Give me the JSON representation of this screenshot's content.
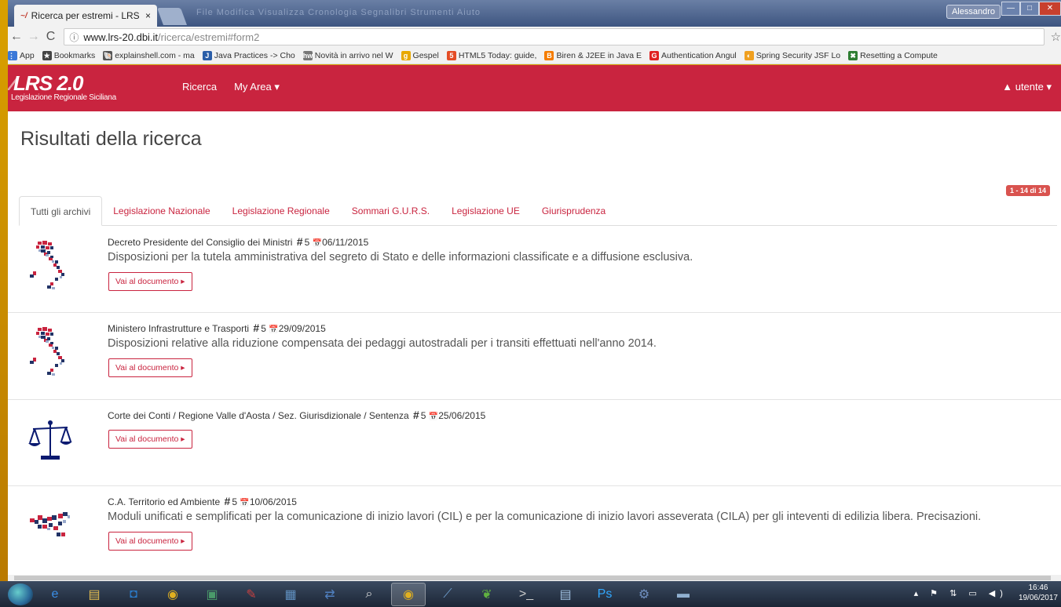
{
  "browser": {
    "tab_title": "Ricerca per estremi - LRS",
    "tab_favicon": "~/",
    "tab_close": "×",
    "blurred_menu": "File   Modifica   Visualizza   Cronologia   Segnalibri   Strumenti   Aiuto",
    "window_user": "Alessandro",
    "window_minimize": "—",
    "window_maximize": "□",
    "window_close": "✕",
    "nav_back": "←",
    "nav_forward": "→",
    "nav_reload": "C",
    "url_info": "ⓘ",
    "url_host": "www.lrs-20.dbi.it",
    "url_path": "/ricerca/estremi#form2",
    "bookmark_star": "☆",
    "bookmarks": [
      {
        "label": "App",
        "icon": "⋮⋮",
        "color": "#3a78d8"
      },
      {
        "label": "Bookmarks",
        "icon": "★",
        "color": "#444444"
      },
      {
        "label": "explainshell.com - ma",
        "icon": "🐚",
        "color": "#555555"
      },
      {
        "label": "Java Practices -> Cho",
        "icon": "J",
        "color": "#2b5ea8"
      },
      {
        "label": "Novità in arrivo nel W",
        "icon": "hw",
        "color": "#777777"
      },
      {
        "label": "Gespel",
        "icon": "g",
        "color": "#e8a800"
      },
      {
        "label": "HTML5 Today: guide,",
        "icon": "5",
        "color": "#e44d26"
      },
      {
        "label": "Biren & J2EE in Java E",
        "icon": "B",
        "color": "#f57c00"
      },
      {
        "label": "Authentication Angul",
        "icon": "G",
        "color": "#e02020"
      },
      {
        "label": "Spring Security JSF Lo",
        "icon": "◐",
        "color": "#f0a020"
      },
      {
        "label": "Resetting a Compute",
        "icon": "✖",
        "color": "#2e7d32"
      }
    ]
  },
  "site": {
    "logo_main": "LRS 2.0",
    "logo_sub": "Legislazione Regionale Siciliana",
    "nav": [
      "Ricerca",
      "My Area ▾"
    ],
    "user_menu": "▲ utente ▾"
  },
  "page": {
    "title": "Risultati della ricerca",
    "count_badge": "1 - 14 di 14",
    "tabs": [
      {
        "label": "Tutti gli archivi",
        "active": true
      },
      {
        "label": "Legislazione Nazionale",
        "active": false
      },
      {
        "label": "Legislazione Regionale",
        "active": false
      },
      {
        "label": "Sommari G.U.R.S.",
        "active": false
      },
      {
        "label": "Legislazione UE",
        "active": false
      },
      {
        "label": "Giurisprudenza",
        "active": false
      }
    ],
    "results": [
      {
        "icon": "italy-map-icon",
        "source": "Decreto Presidente del Consiglio dei Ministri",
        "hash": "#",
        "number": "5",
        "calendar": "📅",
        "date": "06/11/2015",
        "description": "Disposizioni per la tutela amministrativa del segreto di Stato e delle informazioni classificate e a diffusione esclusiva.",
        "button": "Vai al documento ▸"
      },
      {
        "icon": "italy-map-icon",
        "source": "Ministero Infrastrutture e Trasporti",
        "hash": "#",
        "number": "5",
        "calendar": "📅",
        "date": "29/09/2015",
        "description": "Disposizioni relative alla riduzione compensata dei pedaggi autostradali per i transiti effettuati nell'anno 2014.",
        "button": "Vai al documento ▸"
      },
      {
        "icon": "scales-of-justice-icon",
        "source": "Corte dei Conti / Regione Valle d'Aosta / Sez. Giurisdizionale / Sentenza",
        "hash": "#",
        "number": "5",
        "calendar": "📅",
        "date": "25/06/2015",
        "description": "",
        "button": "Vai al documento ▸"
      },
      {
        "icon": "sicily-map-icon",
        "source": "C.A. Territorio ed Ambiente",
        "hash": "#",
        "number": "5",
        "calendar": "📅",
        "date": "10/06/2015",
        "description": "Moduli unificati e semplificati per la comunicazione di inizio lavori (CIL) e per la comunicazione di inizio lavori asseverata (CILA) per gli inteventi di edilizia libera. Precisazioni.",
        "button": "Vai al documento ▸"
      }
    ]
  },
  "taskbar": {
    "apps": [
      {
        "icon": "e",
        "name": "internet-explorer-icon",
        "color": "#3a8ee6"
      },
      {
        "icon": "▤",
        "name": "file-explorer-icon",
        "color": "#e8c050"
      },
      {
        "icon": "◘",
        "name": "outlook-icon",
        "color": "#2a7ac8"
      },
      {
        "icon": "◉",
        "name": "chrome-icon",
        "color": "#e0b020"
      },
      {
        "icon": "▣",
        "name": "network-app-icon",
        "color": "#4a9a6a"
      },
      {
        "icon": "✎",
        "name": "editor-app-icon",
        "color": "#c84040"
      },
      {
        "icon": "▦",
        "name": "window-app-icon",
        "color": "#6090c0"
      },
      {
        "icon": "⇄",
        "name": "remote-desktop-icon",
        "color": "#5080c0"
      },
      {
        "icon": "⌕",
        "name": "search-app-icon",
        "color": "#dddddd"
      },
      {
        "icon": "◉",
        "name": "chrome-active-icon",
        "color": "#e0b020"
      },
      {
        "icon": "⟋",
        "name": "vscode-icon",
        "color": "#70a0d0"
      },
      {
        "icon": "❦",
        "name": "evernote-icon",
        "color": "#60b040"
      },
      {
        "icon": ">_",
        "name": "terminal-icon",
        "color": "#cccccc"
      },
      {
        "icon": "▤",
        "name": "app-window-icon",
        "color": "#a0c0e0"
      },
      {
        "icon": "Ps",
        "name": "photoshop-icon",
        "color": "#31a8ff"
      },
      {
        "icon": "⚙",
        "name": "tools-app-icon",
        "color": "#7090c0"
      },
      {
        "icon": "▬",
        "name": "image-viewer-icon",
        "color": "#90b0d0"
      }
    ],
    "tray_icons": "▴ ⚑ ⇅ ▭ ◀)",
    "time": "16:46",
    "date": "19/06/2017"
  }
}
